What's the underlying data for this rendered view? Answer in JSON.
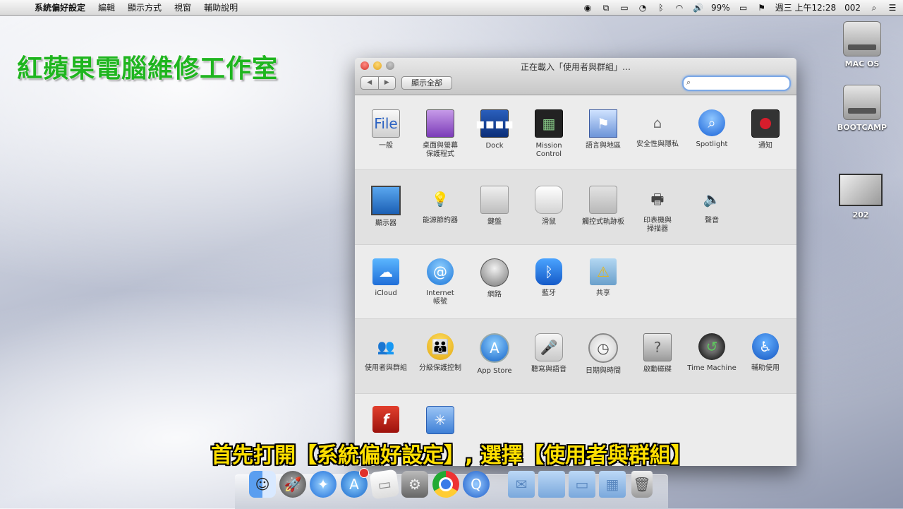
{
  "menubar": {
    "apple": "",
    "app_name": "系統偏好設定",
    "items": [
      "編輯",
      "顯示方式",
      "視窗",
      "輔助說明"
    ],
    "battery": "99%",
    "clock": "週三 上午12:28",
    "user": "002"
  },
  "watermark": "紅蘋果電腦維修工作室",
  "desktop_icons": [
    {
      "label": "MAC OS"
    },
    {
      "label": "BOOTCAMP"
    },
    {
      "label": "202"
    }
  ],
  "window": {
    "title": "正在載入「使用者與群組」…",
    "show_all": "顯示全部",
    "search_placeholder": "",
    "rows": [
      [
        {
          "label": "一般",
          "icon": "general-icon",
          "glyph": "File"
        },
        {
          "label": "桌面與螢幕\n保護程式",
          "icon": "desktop-icon",
          "glyph": ""
        },
        {
          "label": "Dock",
          "icon": "dock-icon",
          "glyph": "▪▪▪▪"
        },
        {
          "label": "Mission\nControl",
          "icon": "mission-control-icon",
          "glyph": "▦"
        },
        {
          "label": "語言與地區",
          "icon": "language-icon",
          "glyph": "⚑"
        },
        {
          "label": "安全性與隱私",
          "icon": "security-icon",
          "glyph": "⌂"
        },
        {
          "label": "Spotlight",
          "icon": "spotlight-icon",
          "glyph": "⌕"
        },
        {
          "label": "通知",
          "icon": "notifications-icon",
          "glyph": ""
        }
      ],
      [
        {
          "label": "顯示器",
          "icon": "display-icon",
          "glyph": ""
        },
        {
          "label": "能源節約器",
          "icon": "energy-icon",
          "glyph": "💡"
        },
        {
          "label": "鍵盤",
          "icon": "keyboard-icon",
          "glyph": ""
        },
        {
          "label": "滑鼠",
          "icon": "mouse-icon",
          "glyph": ""
        },
        {
          "label": "觸控式軌跡板",
          "icon": "trackpad-icon",
          "glyph": ""
        },
        {
          "label": "印表機與\n掃描器",
          "icon": "printer-icon",
          "glyph": "🖶"
        },
        {
          "label": "聲音",
          "icon": "sound-icon",
          "glyph": "🔈"
        }
      ],
      [
        {
          "label": "iCloud",
          "icon": "icloud-icon",
          "glyph": "☁"
        },
        {
          "label": "Internet\n帳號",
          "icon": "internet-accounts-icon",
          "glyph": "@"
        },
        {
          "label": "網路",
          "icon": "network-icon",
          "glyph": ""
        },
        {
          "label": "藍牙",
          "icon": "bluetooth-icon",
          "glyph": "ᛒ"
        },
        {
          "label": "共享",
          "icon": "sharing-icon",
          "glyph": "⚠"
        }
      ],
      [
        {
          "label": "使用者與群組",
          "icon": "users-groups-icon",
          "glyph": "👥"
        },
        {
          "label": "分級保護控制",
          "icon": "parental-controls-icon",
          "glyph": "👪"
        },
        {
          "label": "App Store",
          "icon": "app-store-icon",
          "glyph": "A"
        },
        {
          "label": "聽寫與語音",
          "icon": "dictation-icon",
          "glyph": "🎤"
        },
        {
          "label": "日期與時間",
          "icon": "date-time-icon",
          "glyph": "◷"
        },
        {
          "label": "啟動磁碟",
          "icon": "startup-disk-icon",
          "glyph": "?"
        },
        {
          "label": "Time Machine",
          "icon": "time-machine-icon",
          "glyph": "↺"
        },
        {
          "label": "輔助使用",
          "icon": "accessibility-icon",
          "glyph": "♿"
        }
      ],
      [
        {
          "label": "",
          "icon": "flash-player-icon",
          "glyph": "f"
        },
        {
          "label": "",
          "icon": "other-pref-icon",
          "glyph": "✳"
        }
      ]
    ]
  },
  "subtitle": "首先打開【系統偏好設定】, 選擇【使用者與群組】",
  "dock": [
    {
      "name": "finder",
      "glyph": "☺"
    },
    {
      "name": "launchpad",
      "glyph": "🚀"
    },
    {
      "name": "safari",
      "glyph": "✦"
    },
    {
      "name": "app-store",
      "glyph": "A"
    },
    {
      "name": "preview",
      "glyph": "▭"
    },
    {
      "name": "system-preferences",
      "glyph": "⚙"
    },
    {
      "name": "chrome",
      "glyph": ""
    },
    {
      "name": "quicktime",
      "glyph": "Q"
    },
    {
      "name": "folder-1",
      "glyph": "✉"
    },
    {
      "name": "folder-2",
      "glyph": ""
    },
    {
      "name": "folder-3",
      "glyph": "▭"
    },
    {
      "name": "folder-4",
      "glyph": "▦"
    },
    {
      "name": "trash",
      "glyph": "🗑"
    }
  ]
}
